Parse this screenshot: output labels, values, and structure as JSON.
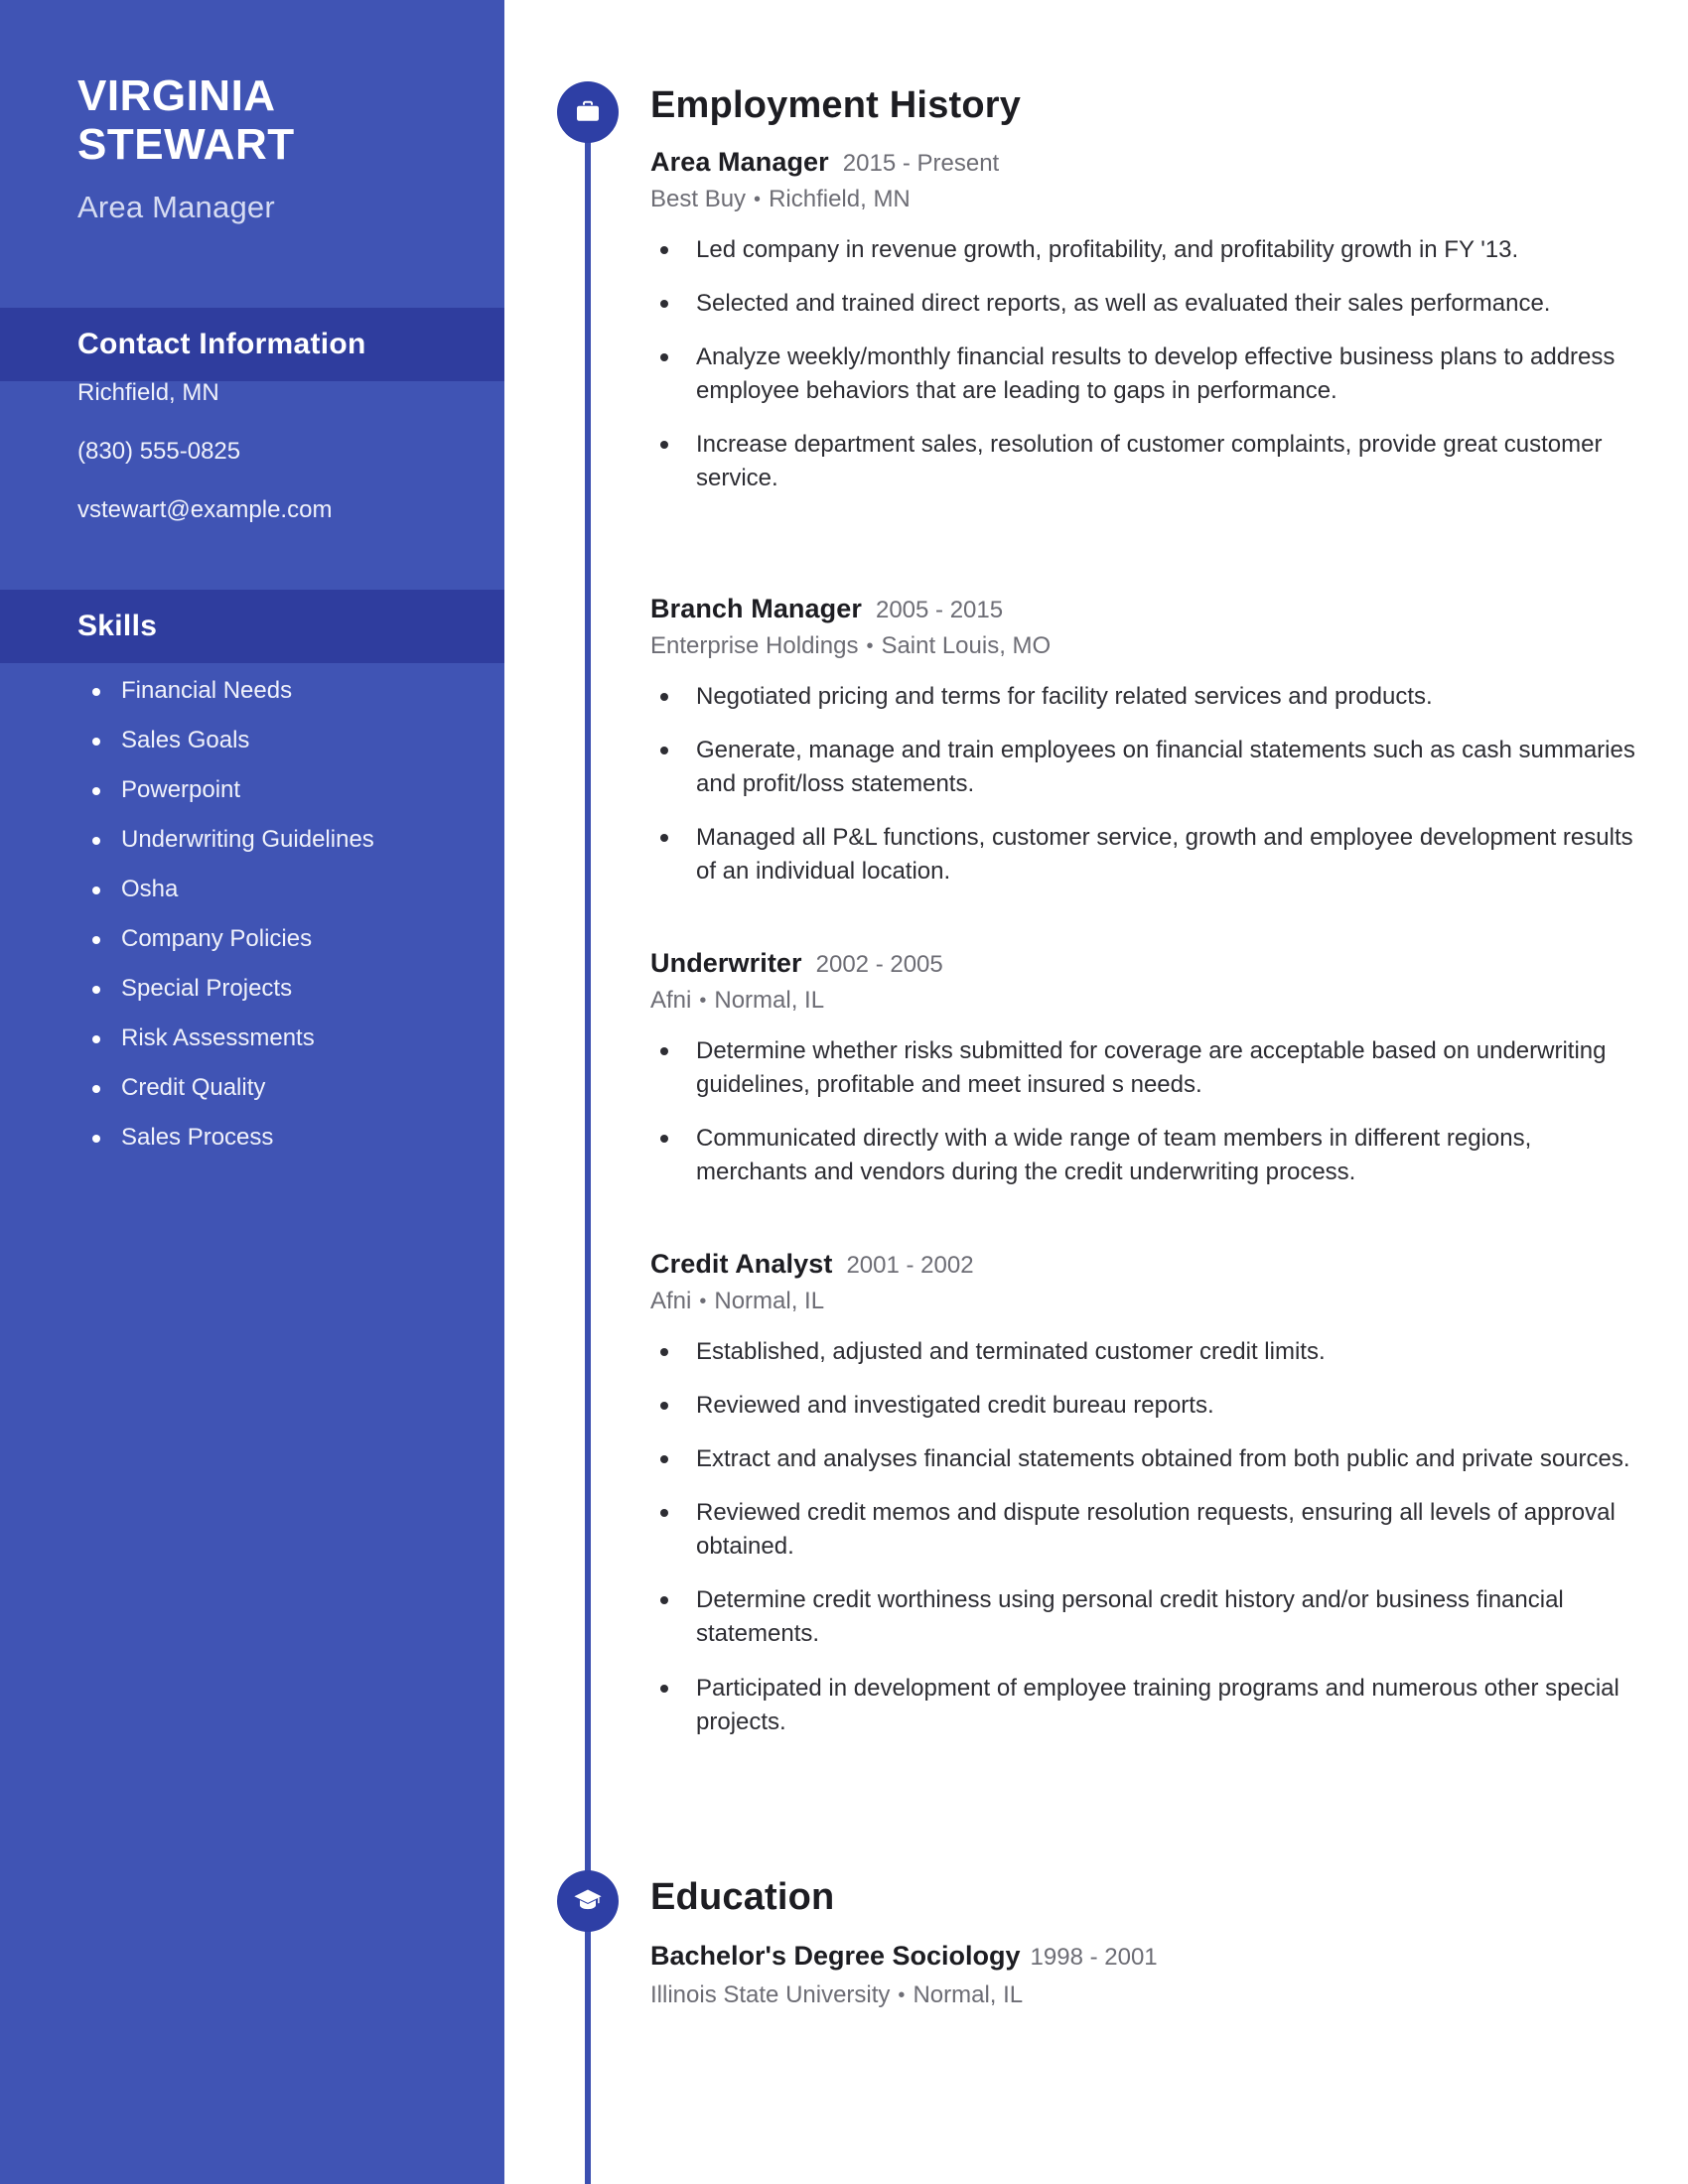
{
  "colors": {
    "sidebar_bg": "#4054b4",
    "sidebar_band_bg": "#2f3d9e",
    "timeline": "#3b4fb0",
    "badge": "#2e3fa5",
    "heading_text": "#1d1d22",
    "muted_text": "#6d6d75"
  },
  "sidebar": {
    "name_first": "VIRGINIA",
    "name_last": "STEWART",
    "job_title": "Area Manager",
    "contact": {
      "heading": "Contact Information",
      "lines": [
        "Richfield, MN",
        "(830) 555-0825",
        "vstewart@example.com"
      ]
    },
    "skills": {
      "heading": "Skills",
      "items": [
        "Financial Needs",
        "Sales Goals",
        "Powerpoint",
        "Underwriting Guidelines",
        "Osha",
        "Company Policies",
        "Special Projects",
        "Risk Assessments",
        "Credit Quality",
        "Sales Process"
      ]
    }
  },
  "employment": {
    "heading": "Employment History",
    "icon": "briefcase-icon",
    "entries": [
      {
        "role": "Area Manager",
        "dates": "2015 - Present",
        "company": "Best Buy",
        "location": "Richfield, MN",
        "bullets": [
          "Led company in revenue growth, profitability, and profitability growth in FY '13.",
          "Selected and trained direct reports, as well as evaluated their sales performance.",
          "Analyze weekly/monthly financial results to develop effective business plans to address employee behaviors that are leading to gaps in performance.",
          "Increase department sales, resolution of customer complaints, provide great customer service."
        ]
      },
      {
        "role": "Branch Manager",
        "dates": "2005 - 2015",
        "company": "Enterprise Holdings",
        "location": "Saint Louis, MO",
        "bullets": [
          "Negotiated pricing and terms for facility related services and products.",
          "Generate, manage and train employees on financial statements such as cash summaries and profit/loss statements.",
          "Managed all P&L functions, customer service, growth and employee development results of an individual location."
        ]
      },
      {
        "role": "Underwriter",
        "dates": "2002 - 2005",
        "company": "Afni",
        "location": "Normal, IL",
        "bullets": [
          "Determine whether risks submitted for coverage are acceptable based on underwriting guidelines, profitable and meet insured s needs.",
          "Communicated directly with a wide range of team members in different regions, merchants and vendors during the credit underwriting process."
        ]
      },
      {
        "role": "Credit Analyst",
        "dates": "2001 - 2002",
        "company": "Afni",
        "location": "Normal, IL",
        "bullets": [
          "Established, adjusted and terminated customer credit limits.",
          "Reviewed and investigated credit bureau reports.",
          "Extract and analyses financial statements obtained from both public and private sources.",
          "Reviewed credit memos and dispute resolution requests, ensuring all levels of approval obtained.",
          "Determine credit worthiness using personal credit history and/or business financial statements.",
          "Participated in development of employee training programs and numerous other special projects."
        ]
      }
    ]
  },
  "education": {
    "heading": "Education",
    "icon": "graduation-cap-icon",
    "entries": [
      {
        "degree": "Bachelor's Degree Sociology",
        "dates": "1998 - 2001",
        "school": "Illinois State University",
        "location": "Normal, IL"
      }
    ]
  }
}
